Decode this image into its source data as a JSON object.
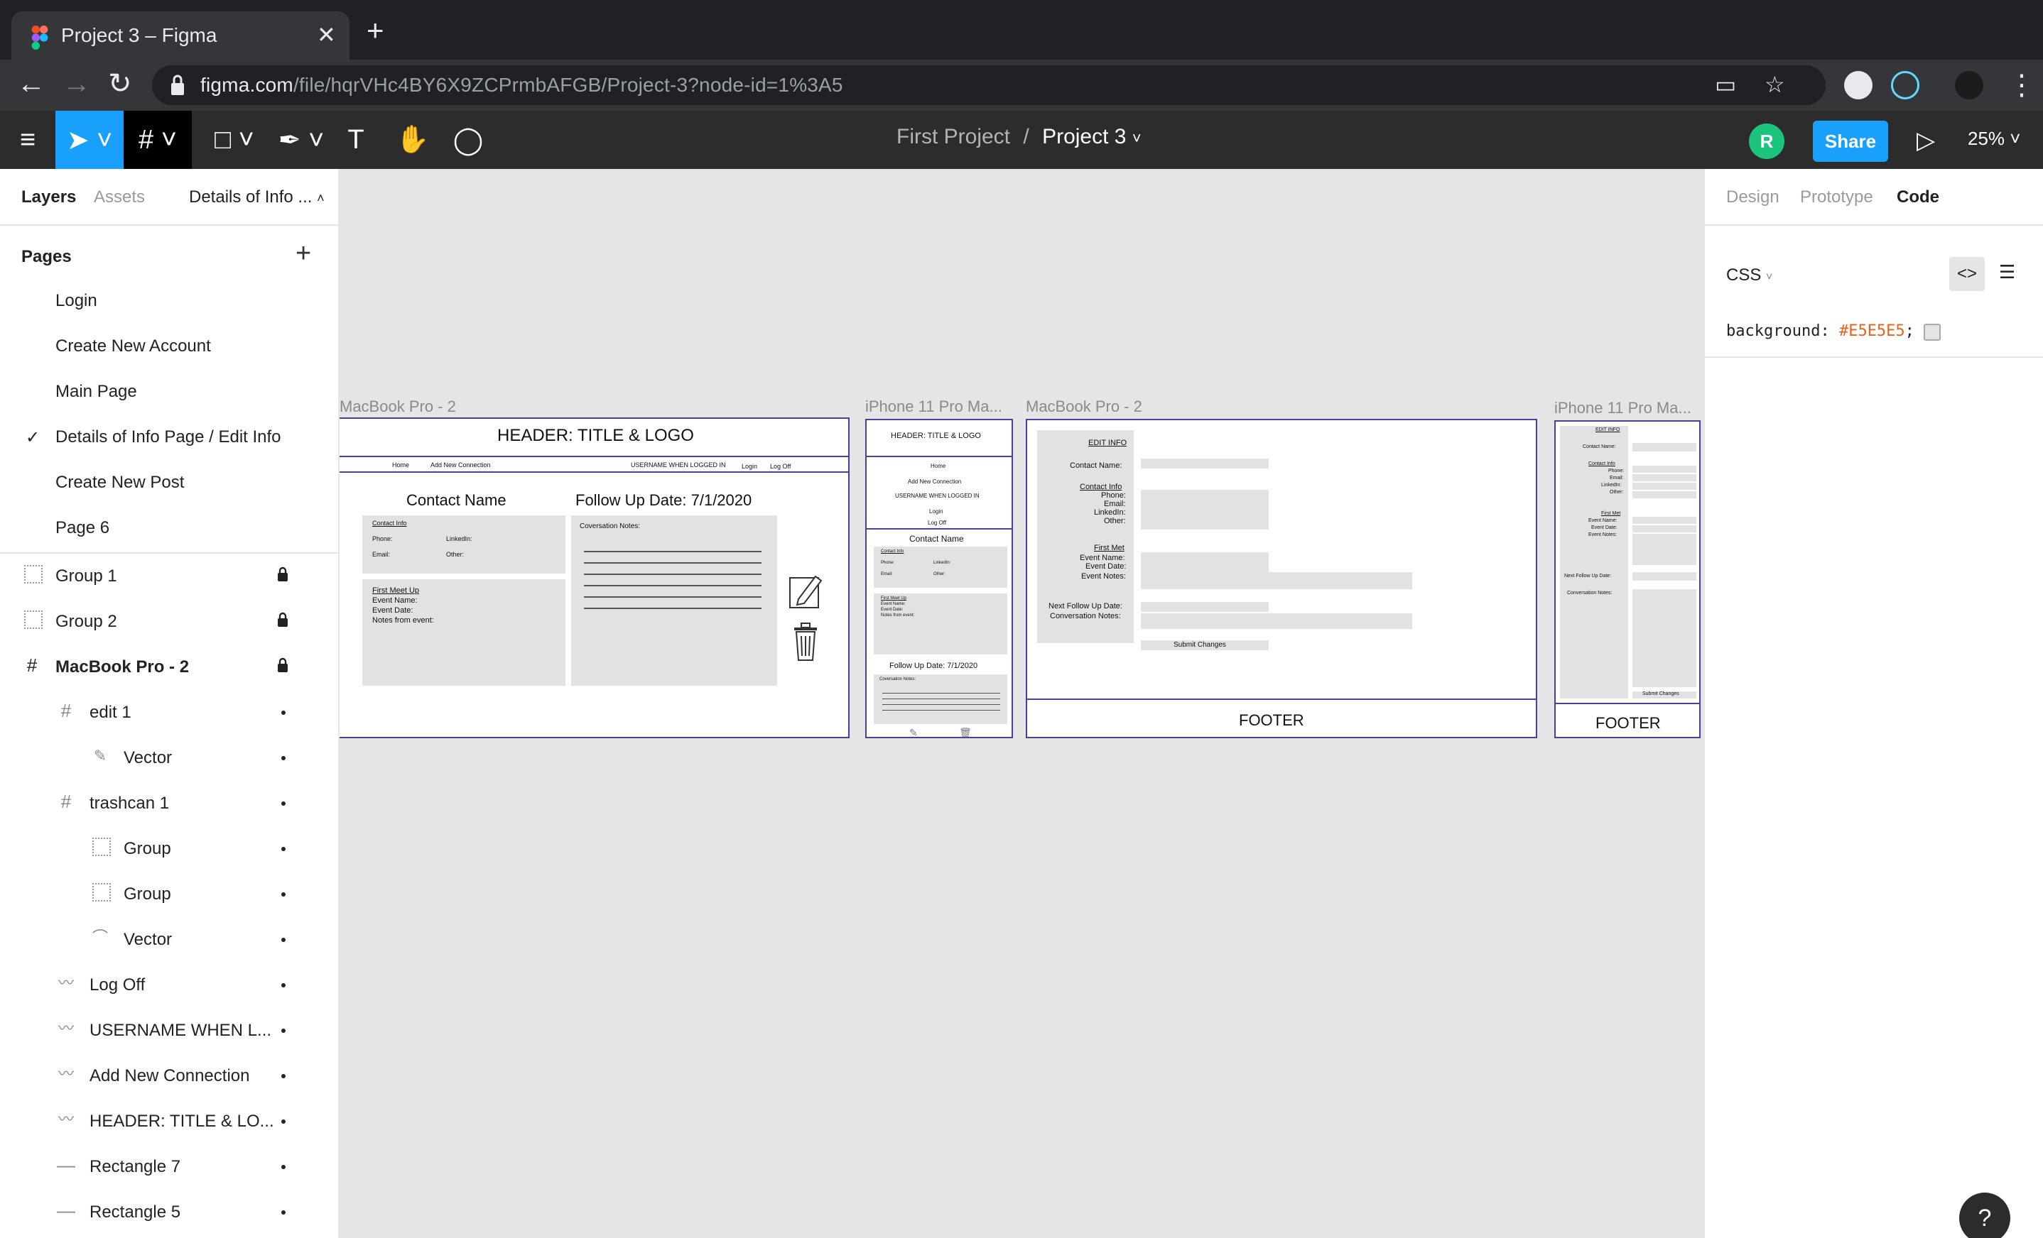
{
  "browser": {
    "tab_title": "Project 3 – Figma",
    "url_host": "figma.com",
    "url_path": "/file/hqrVHc4BY6X9ZCPrmbAFGB/Project-3?node-id=1%3A5"
  },
  "toolbar": {
    "breadcrumb_parent": "First Project",
    "breadcrumb_sep": "/",
    "breadcrumb_current": "Project 3",
    "avatar_initial": "R",
    "share_label": "Share",
    "zoom": "25%"
  },
  "left_panel": {
    "tabs": [
      "Layers",
      "Assets"
    ],
    "page_selector": "Details of Info ...",
    "pages_heading": "Pages",
    "pages": [
      "Login",
      "Create New Account",
      "Main Page",
      "Details of Info Page / Edit Info",
      "Create New Post",
      "Page 6"
    ],
    "layers": [
      {
        "name": "Group 1",
        "icon": "group-icon"
      },
      {
        "name": "Group 2",
        "icon": "group-icon"
      },
      {
        "name": "MacBook Pro - 2",
        "icon": "frame-icon"
      },
      {
        "name": "edit 1",
        "icon": "frame-icon"
      },
      {
        "name": "Vector",
        "icon": "vector-icon"
      },
      {
        "name": "trashcan 1",
        "icon": "frame-icon"
      },
      {
        "name": "Group",
        "icon": "group-icon"
      },
      {
        "name": "Group",
        "icon": "group-icon"
      },
      {
        "name": "Vector",
        "icon": "vector-icon"
      },
      {
        "name": "Log Off",
        "icon": "text-icon"
      },
      {
        "name": "USERNAME WHEN L...",
        "icon": "text-icon"
      },
      {
        "name": "Add New Connection",
        "icon": "text-icon"
      },
      {
        "name": "HEADER: TITLE & LO...",
        "icon": "text-icon"
      },
      {
        "name": "Rectangle 7",
        "icon": "line-icon"
      },
      {
        "name": "Rectangle 5",
        "icon": "line-icon"
      }
    ]
  },
  "right_panel": {
    "tabs": [
      "Design",
      "Prototype",
      "Code"
    ],
    "language": "CSS",
    "css_prop": "background:",
    "css_value": "#E5E5E5",
    "css_end": ";"
  },
  "canvas": {
    "frame1": {
      "label": "MacBook Pro - 2",
      "header": "HEADER: TITLE & LOGO",
      "nav_home": "Home",
      "nav_add": "Add New Connection",
      "nav_user": "USERNAME WHEN LOGGED  IN",
      "nav_login": "Login",
      "nav_logoff": "Log Off",
      "contact_name": "Contact Name",
      "follow_up": "Follow Up Date: 7/1/2020",
      "contact_info": "Contact Info",
      "phone": "Phone:",
      "linkedin": "LinkedIn:",
      "email": "Email:",
      "other": "Other:",
      "first_meet": "First Meet Up",
      "event_name": "Event Name:",
      "event_date": "Event Date:",
      "notes_event": "Notes from event:",
      "conv_notes": "Coversation Notes:"
    },
    "frame2": {
      "label": "iPhone 11 Pro Ma...",
      "header": "HEADER: TITLE & LOGO",
      "home": "Home",
      "add": "Add New Connection",
      "user": "USERNAME WHEN LOGGED  IN",
      "login": "Login",
      "logoff": "Log Off",
      "contact_name": "Contact Name",
      "contact_info": "Contact Info",
      "phone": "Phone:",
      "linkedin": "LinkedIn:",
      "email": "Email:",
      "other": "Other:",
      "first_meet": "First Meet Up",
      "event_name": "Event Name:",
      "event_date": "Event Date:",
      "notes": "Notes from event:",
      "follow_up": "Follow Up Date: 7/1/2020",
      "conv_notes": "Coversation Notes:"
    },
    "frame3": {
      "label": "MacBook Pro - 2",
      "edit_info": "EDIT INFO",
      "contact_name": "Contact Name:",
      "contact_info": "Contact Info",
      "phone": "Phone:",
      "email": "Email:",
      "linkedin": "LinkedIn:",
      "other": "Other:",
      "first_met": "First Met",
      "event_name": "Event Name:",
      "event_date": "Event Date:",
      "event_notes": "Event Notes:",
      "next_follow": "Next Follow Up Date:",
      "conv_notes": "Conversation Notes:",
      "submit": "Submit Changes",
      "footer": "FOOTER"
    },
    "frame4": {
      "label": "iPhone 11 Pro Ma...",
      "edit_info": "EDIT INFO",
      "contact_name": "Contact Name:",
      "contact_info": "Contact Info",
      "phone": "Phone:",
      "email": "Email:",
      "linkedin": "LinkedIn:",
      "other": "Other:",
      "first_met": "First Met",
      "event_name": "Event Name:",
      "event_date": "Event Date:",
      "event_notes": "Event Notes:",
      "next_follow": "Next Follow Up Date:",
      "conv_notes": "Conversation Notes:",
      "submit": "Submit Changes",
      "footer": "FOOTER"
    }
  }
}
